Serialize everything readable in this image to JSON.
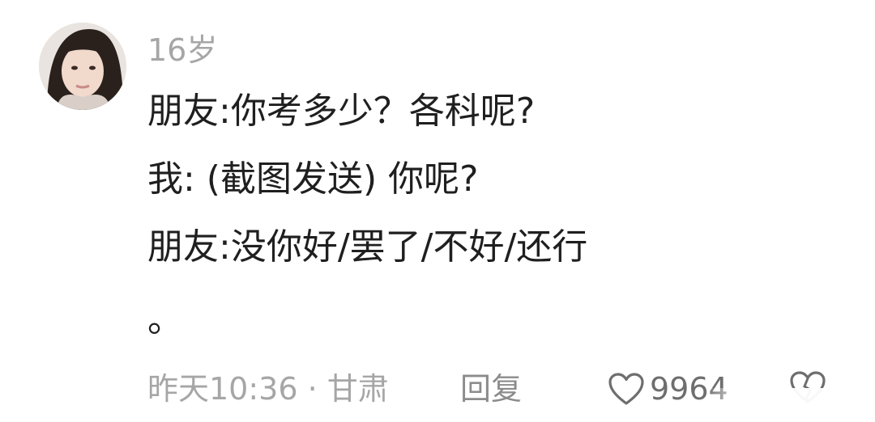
{
  "comment": {
    "username": "16岁",
    "lines": [
      "朋友:你考多少？各科呢?",
      "我: (截图发送) 你呢?",
      "朋友:没你好/罢了/不好/还行",
      "。"
    ],
    "meta": "昨天10:36 · 甘肃",
    "reply_label": "回复",
    "like_count": "9964"
  },
  "colors": {
    "text": "#1f1f1f",
    "muted": "#a6a6a6",
    "icon": "#6e6e6e",
    "background": "#ffffff"
  },
  "icons": {
    "like": "heart-outline-icon",
    "dislike": "heart-broken-outline-icon"
  }
}
